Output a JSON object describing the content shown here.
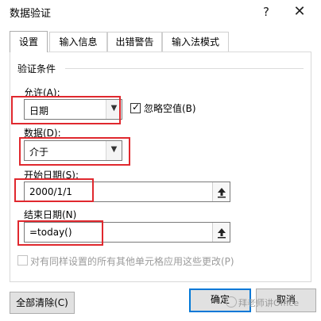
{
  "window": {
    "title": "数据验证",
    "help_label": "?",
    "close_label": "✕"
  },
  "tabs": [
    {
      "label": "设置",
      "active": true
    },
    {
      "label": "输入信息",
      "active": false
    },
    {
      "label": "出错警告",
      "active": false
    },
    {
      "label": "输入法模式",
      "active": false
    }
  ],
  "validation": {
    "group_title": "验证条件",
    "allow": {
      "label": "允许(A):",
      "value": "日期"
    },
    "ignore_blank": {
      "label": "忽略空值(B)",
      "checked": true
    },
    "data": {
      "label": "数据(D):",
      "value": "介于"
    },
    "start_date": {
      "label": "开始日期(S):",
      "value": "2000/1/1"
    },
    "end_date": {
      "label": "结束日期(N)",
      "value": "=today()"
    },
    "apply_all": {
      "label": "对有同样设置的所有其他单元格应用这些更改(P)",
      "checked": false,
      "enabled": false
    }
  },
  "buttons": {
    "clear_all": "全部清除(C)",
    "ok": "确定",
    "cancel": "取消"
  },
  "watermark": "拜老师讲Office",
  "colors": {
    "highlight": "#e0282e",
    "focus": "#0078d7"
  }
}
